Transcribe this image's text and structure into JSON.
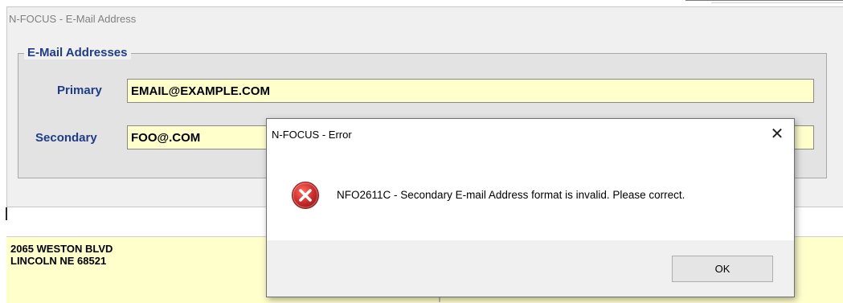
{
  "main_window": {
    "title": "N-FOCUS - E-Mail Address"
  },
  "email_group": {
    "legend": "E-Mail Addresses",
    "primary": {
      "label": "Primary",
      "value": "EMAIL@EXAMPLE.COM"
    },
    "secondary": {
      "label": "Secondary",
      "value": "FOO@.COM"
    }
  },
  "address": {
    "line1": "2065 WESTON BLVD",
    "line2": "LINCOLN NE 68521"
  },
  "error_dialog": {
    "title": "N-FOCUS - Error",
    "close_glyph": "✕",
    "icon": "error-icon",
    "message": "NFO2611C - Secondary E-mail Address format is invalid. Please correct.",
    "ok_label": "OK"
  },
  "colors": {
    "label_blue": "#1f3c88",
    "input_yellow": "#ffffcc",
    "error_red": "#c62828"
  }
}
